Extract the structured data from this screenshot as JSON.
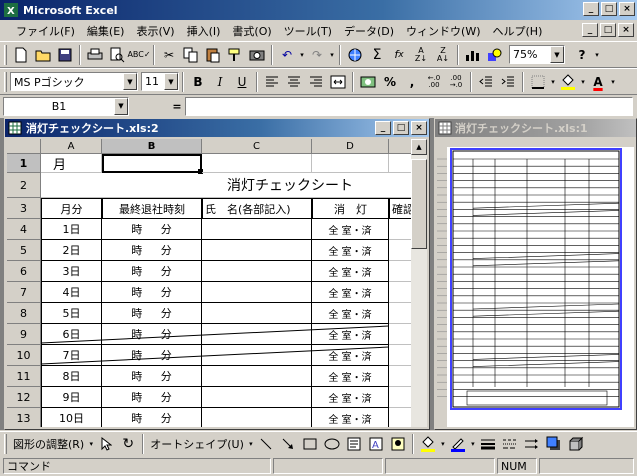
{
  "app": {
    "title": "Microsoft Excel"
  },
  "menu": [
    "ファイル(F)",
    "編集(E)",
    "表示(V)",
    "挿入(I)",
    "書式(O)",
    "ツール(T)",
    "データ(D)",
    "ウィンドウ(W)",
    "ヘルプ(H)"
  ],
  "toolbar": {
    "zoom": "75%",
    "help": "?"
  },
  "format": {
    "font": "MS Pゴシック",
    "size": "11",
    "bold": "B",
    "italic": "I",
    "underline": "U",
    "percent": "%",
    "comma": ","
  },
  "formula": {
    "namebox": "B1",
    "eq": "=",
    "value": ""
  },
  "sheet1": {
    "title": "消灯チェックシート.xls:2",
    "cols": [
      "A",
      "B",
      "C",
      "D"
    ],
    "rows": [
      "1",
      "2",
      "3",
      "4",
      "5",
      "6",
      "7",
      "8",
      "9",
      "10",
      "11",
      "12",
      "13"
    ],
    "a1": "月",
    "header_title": "消灯チェックシート",
    "h_month": "月分",
    "h_time": "最終退社時刻",
    "h_name": "氏　名(各部記入)",
    "h_light": "消　灯",
    "h_check": "確認印",
    "days": [
      "1日",
      "2日",
      "3日",
      "4日",
      "5日",
      "6日",
      "7日",
      "8日",
      "9日",
      "10日"
    ],
    "hour": "時",
    "min": "分",
    "all_done": "全 室・済"
  },
  "sheet2": {
    "title": "消灯チェックシート.xls:1"
  },
  "drawing": {
    "adjust": "図形の調整(R)",
    "autoshape": "オートシェイプ(U)"
  },
  "status": {
    "mode": "コマンド",
    "num": "NUM"
  },
  "colors": {
    "title_active": "#0a246a",
    "face": "#d4d0c8",
    "mdi_bg": "#808080"
  }
}
